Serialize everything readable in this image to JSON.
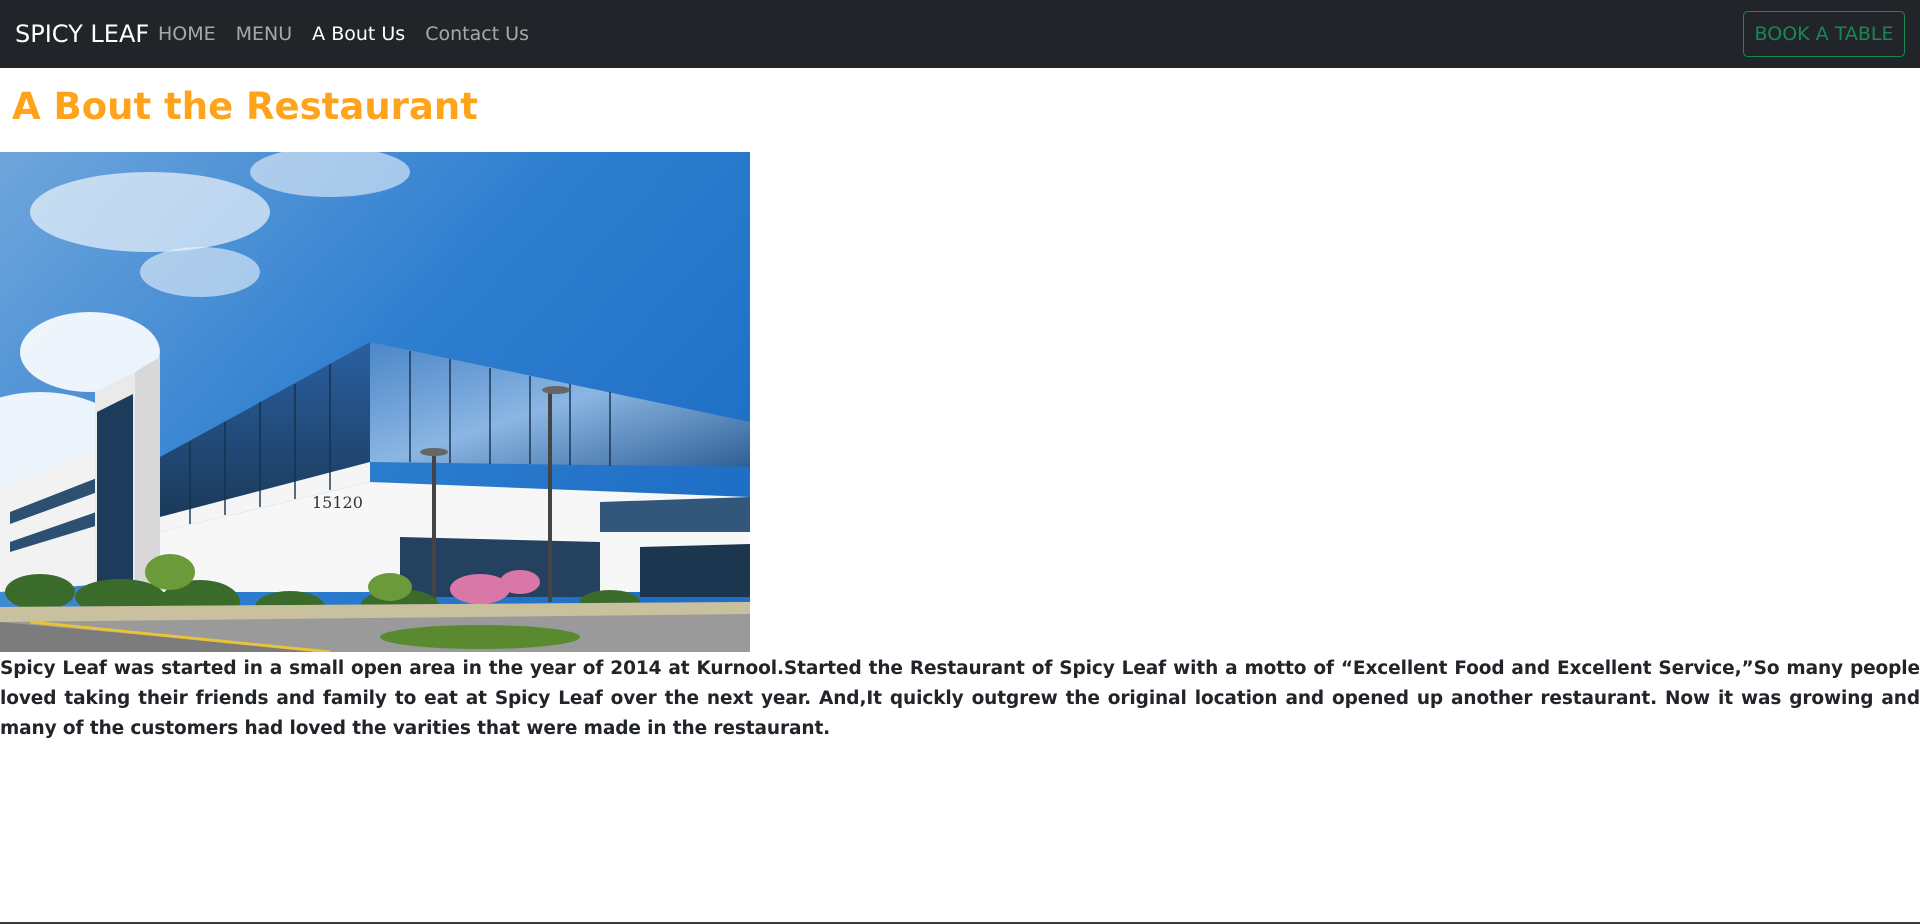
{
  "navbar": {
    "brand": "SPICY LEAF",
    "links": [
      {
        "label": "HOME",
        "active": false
      },
      {
        "label": "MENU",
        "active": false
      },
      {
        "label": "A Bout Us",
        "active": true
      },
      {
        "label": "Contact Us",
        "active": false
      }
    ],
    "cta_label": "BOOK A TABLE"
  },
  "main": {
    "title": "A Bout the Restaurant",
    "photo": {
      "building_number": "15120"
    },
    "paragraph": "Spicy Leaf was started in a small open area in the year of 2014 at Kurnool.Started the Restaurant of Spicy Leaf with a motto of “Excellent Food and Excellent Service,”So many people loved taking their friends and family to eat at Spicy Leaf over the next year. And,It quickly outgrew the original location and opened up another restaurant. Now it was growing and many of the customers had loved the varities that were made in the restaurant."
  },
  "colors": {
    "navbar_bg": "#212529",
    "title": "#ffa31a",
    "cta_border": "#198754"
  }
}
